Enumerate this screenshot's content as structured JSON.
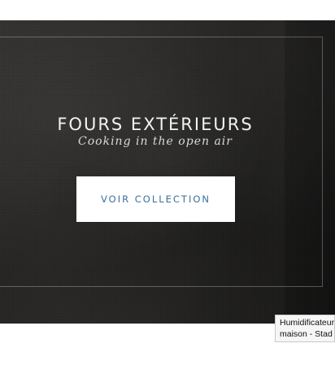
{
  "hero": {
    "title": "FOURS EXTÉRIEURS",
    "subtitle": "Cooking in the open air",
    "button_label": "VOIR COLLECTION",
    "colors": {
      "background": "#2a2928",
      "title": "#f2f2f2",
      "button_bg": "#ffffff",
      "button_text": "#3b6f9e"
    }
  },
  "tooltip": {
    "line1": "Humidificateur",
    "line2": "maison - Stad"
  }
}
